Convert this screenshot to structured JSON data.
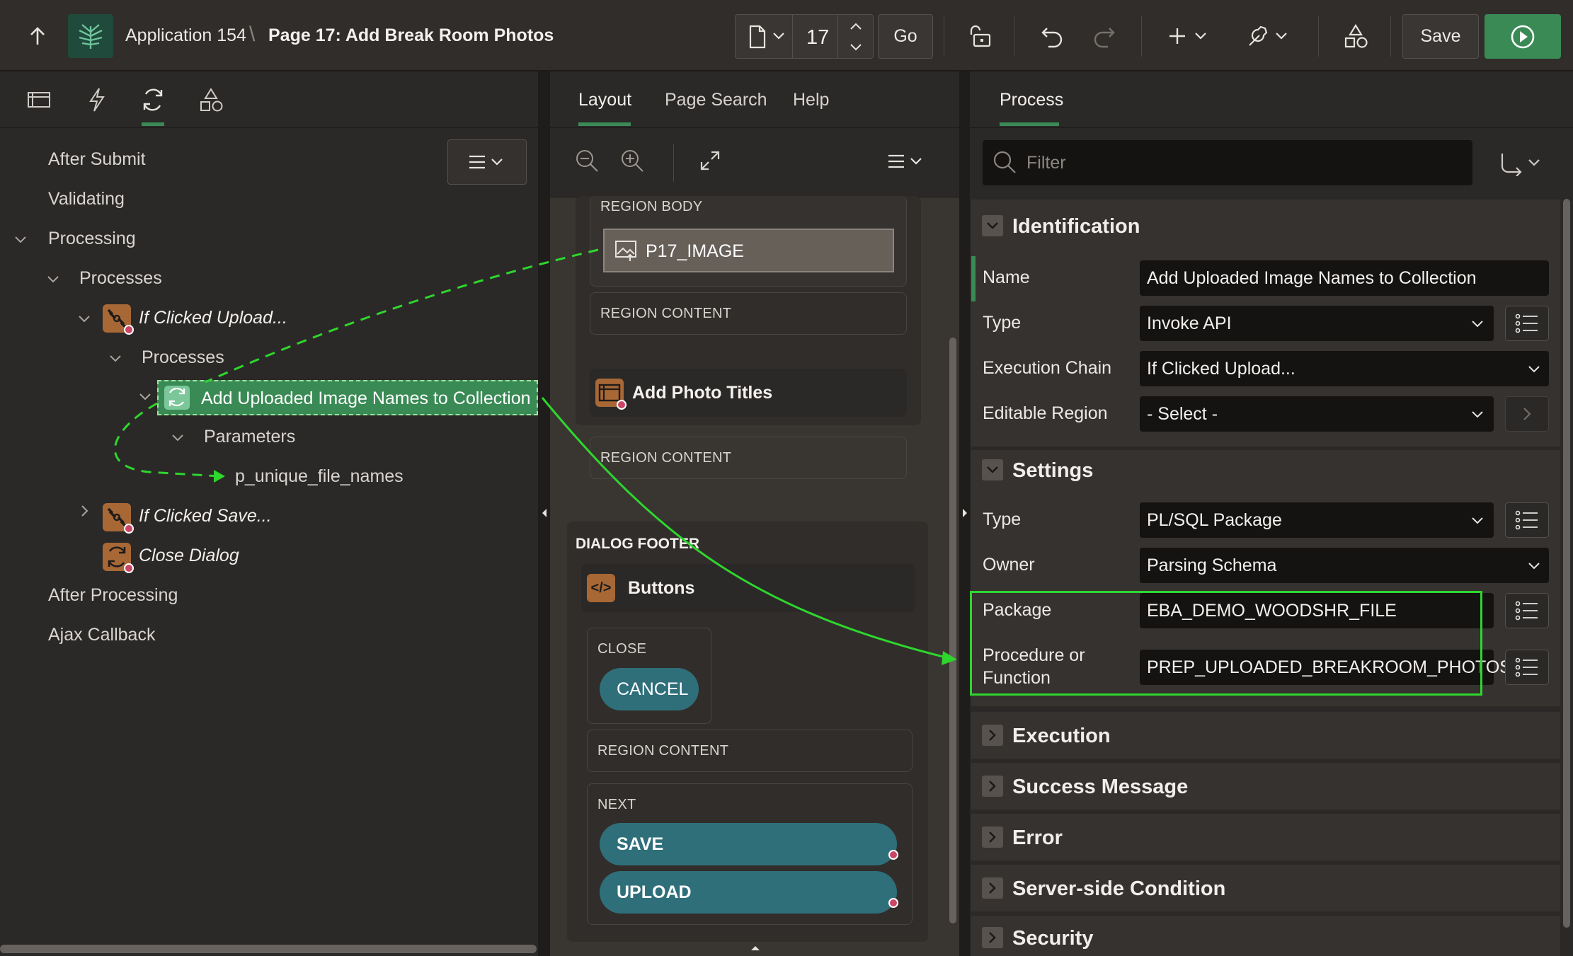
{
  "header": {
    "app_name": "Application 154",
    "separator": "\\",
    "page_title": "Page 17: Add Break Room Photos",
    "page_number": "17",
    "go_label": "Go",
    "save_label": "Save"
  },
  "left_panel": {
    "tree": {
      "after_submit": "After Submit",
      "validating": "Validating",
      "processing": "Processing",
      "processes": "Processes",
      "if_clicked_upload": "If Clicked Upload...",
      "sub_processes": "Processes",
      "selected_process": "Add Uploaded Image Names to Collection",
      "parameters": "Parameters",
      "param_name": "p_unique_file_names",
      "if_clicked_save": "If Clicked Save...",
      "close_dialog": "Close Dialog",
      "after_processing": "After Processing",
      "ajax_callback": "Ajax Callback"
    }
  },
  "middle_panel": {
    "tabs": [
      "Layout",
      "Page Search",
      "Help"
    ],
    "active_tab": "Layout",
    "region_body": "REGION BODY",
    "p17_image": "P17_IMAGE",
    "region_content_1": "REGION CONTENT",
    "add_photo_titles": "Add Photo Titles",
    "region_content_2": "REGION CONTENT",
    "dialog_footer": "DIALOG FOOTER",
    "buttons": "Buttons",
    "close_label": "CLOSE",
    "cancel": "CANCEL",
    "region_content_3": "REGION CONTENT",
    "next_label": "NEXT",
    "save_btn": "SAVE",
    "upload_btn": "UPLOAD"
  },
  "right_panel": {
    "tab": "Process",
    "filter_placeholder": "Filter",
    "identification": {
      "title": "Identification",
      "name_label": "Name",
      "name_value": "Add Uploaded Image Names to Collection",
      "type_label": "Type",
      "type_value": "Invoke API",
      "chain_label": "Execution Chain",
      "chain_value": "If Clicked Upload...",
      "editable_label": "Editable Region",
      "editable_value": "- Select -"
    },
    "settings": {
      "title": "Settings",
      "type_label": "Type",
      "type_value": "PL/SQL Package",
      "owner_label": "Owner",
      "owner_value": "Parsing Schema",
      "package_label": "Package",
      "package_value": "EBA_DEMO_WOODSHR_FILE",
      "proc_label_1": "Procedure or",
      "proc_label_2": "Function",
      "proc_value": "PREP_UPLOADED_BREAKROOM_PHOTOS"
    },
    "collapsed_sections": [
      "Execution",
      "Success Message",
      "Error",
      "Server-side Condition",
      "Security"
    ]
  },
  "colors": {
    "accent_green": "#3a8a55",
    "annotation_green": "#2ed62e",
    "process_icon": "#a86836",
    "button_teal": "#2f6f7a"
  }
}
